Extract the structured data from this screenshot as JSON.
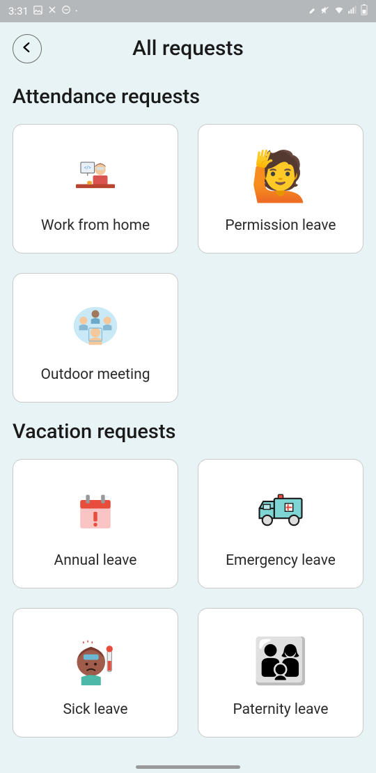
{
  "statusBar": {
    "time": "3:31"
  },
  "header": {
    "title": "All requests"
  },
  "sections": {
    "attendance": {
      "title": "Attendance requests",
      "items": [
        {
          "label": "Work from home"
        },
        {
          "label": "Permission leave"
        },
        {
          "label": "Outdoor meeting"
        }
      ]
    },
    "vacation": {
      "title": "Vacation requests",
      "items": [
        {
          "label": "Annual leave"
        },
        {
          "label": "Emergency leave"
        },
        {
          "label": "Sick leave"
        },
        {
          "label": "Paternity leave"
        }
      ]
    }
  }
}
